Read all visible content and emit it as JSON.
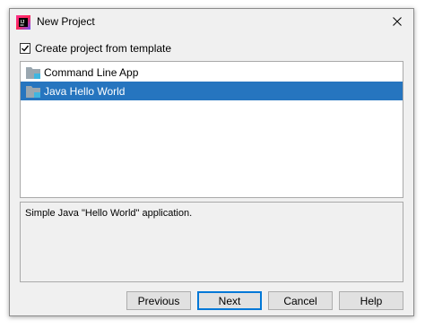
{
  "window": {
    "title": "New Project",
    "icon": "intellij-idea-icon",
    "close_icon": "close-icon"
  },
  "template_checkbox": {
    "label": "Create project from template",
    "checked": true
  },
  "templates": {
    "items": [
      {
        "label": "Command Line App",
        "icon": "folder-icon",
        "selected": false
      },
      {
        "label": "Java Hello World",
        "icon": "folder-icon",
        "selected": true
      }
    ]
  },
  "description": {
    "text": "Simple Java \"Hello World\" application."
  },
  "buttons": {
    "previous": "Previous",
    "next": "Next",
    "cancel": "Cancel",
    "help": "Help"
  },
  "colors": {
    "selection": "#2675bf",
    "default_button_border": "#0078d7"
  }
}
